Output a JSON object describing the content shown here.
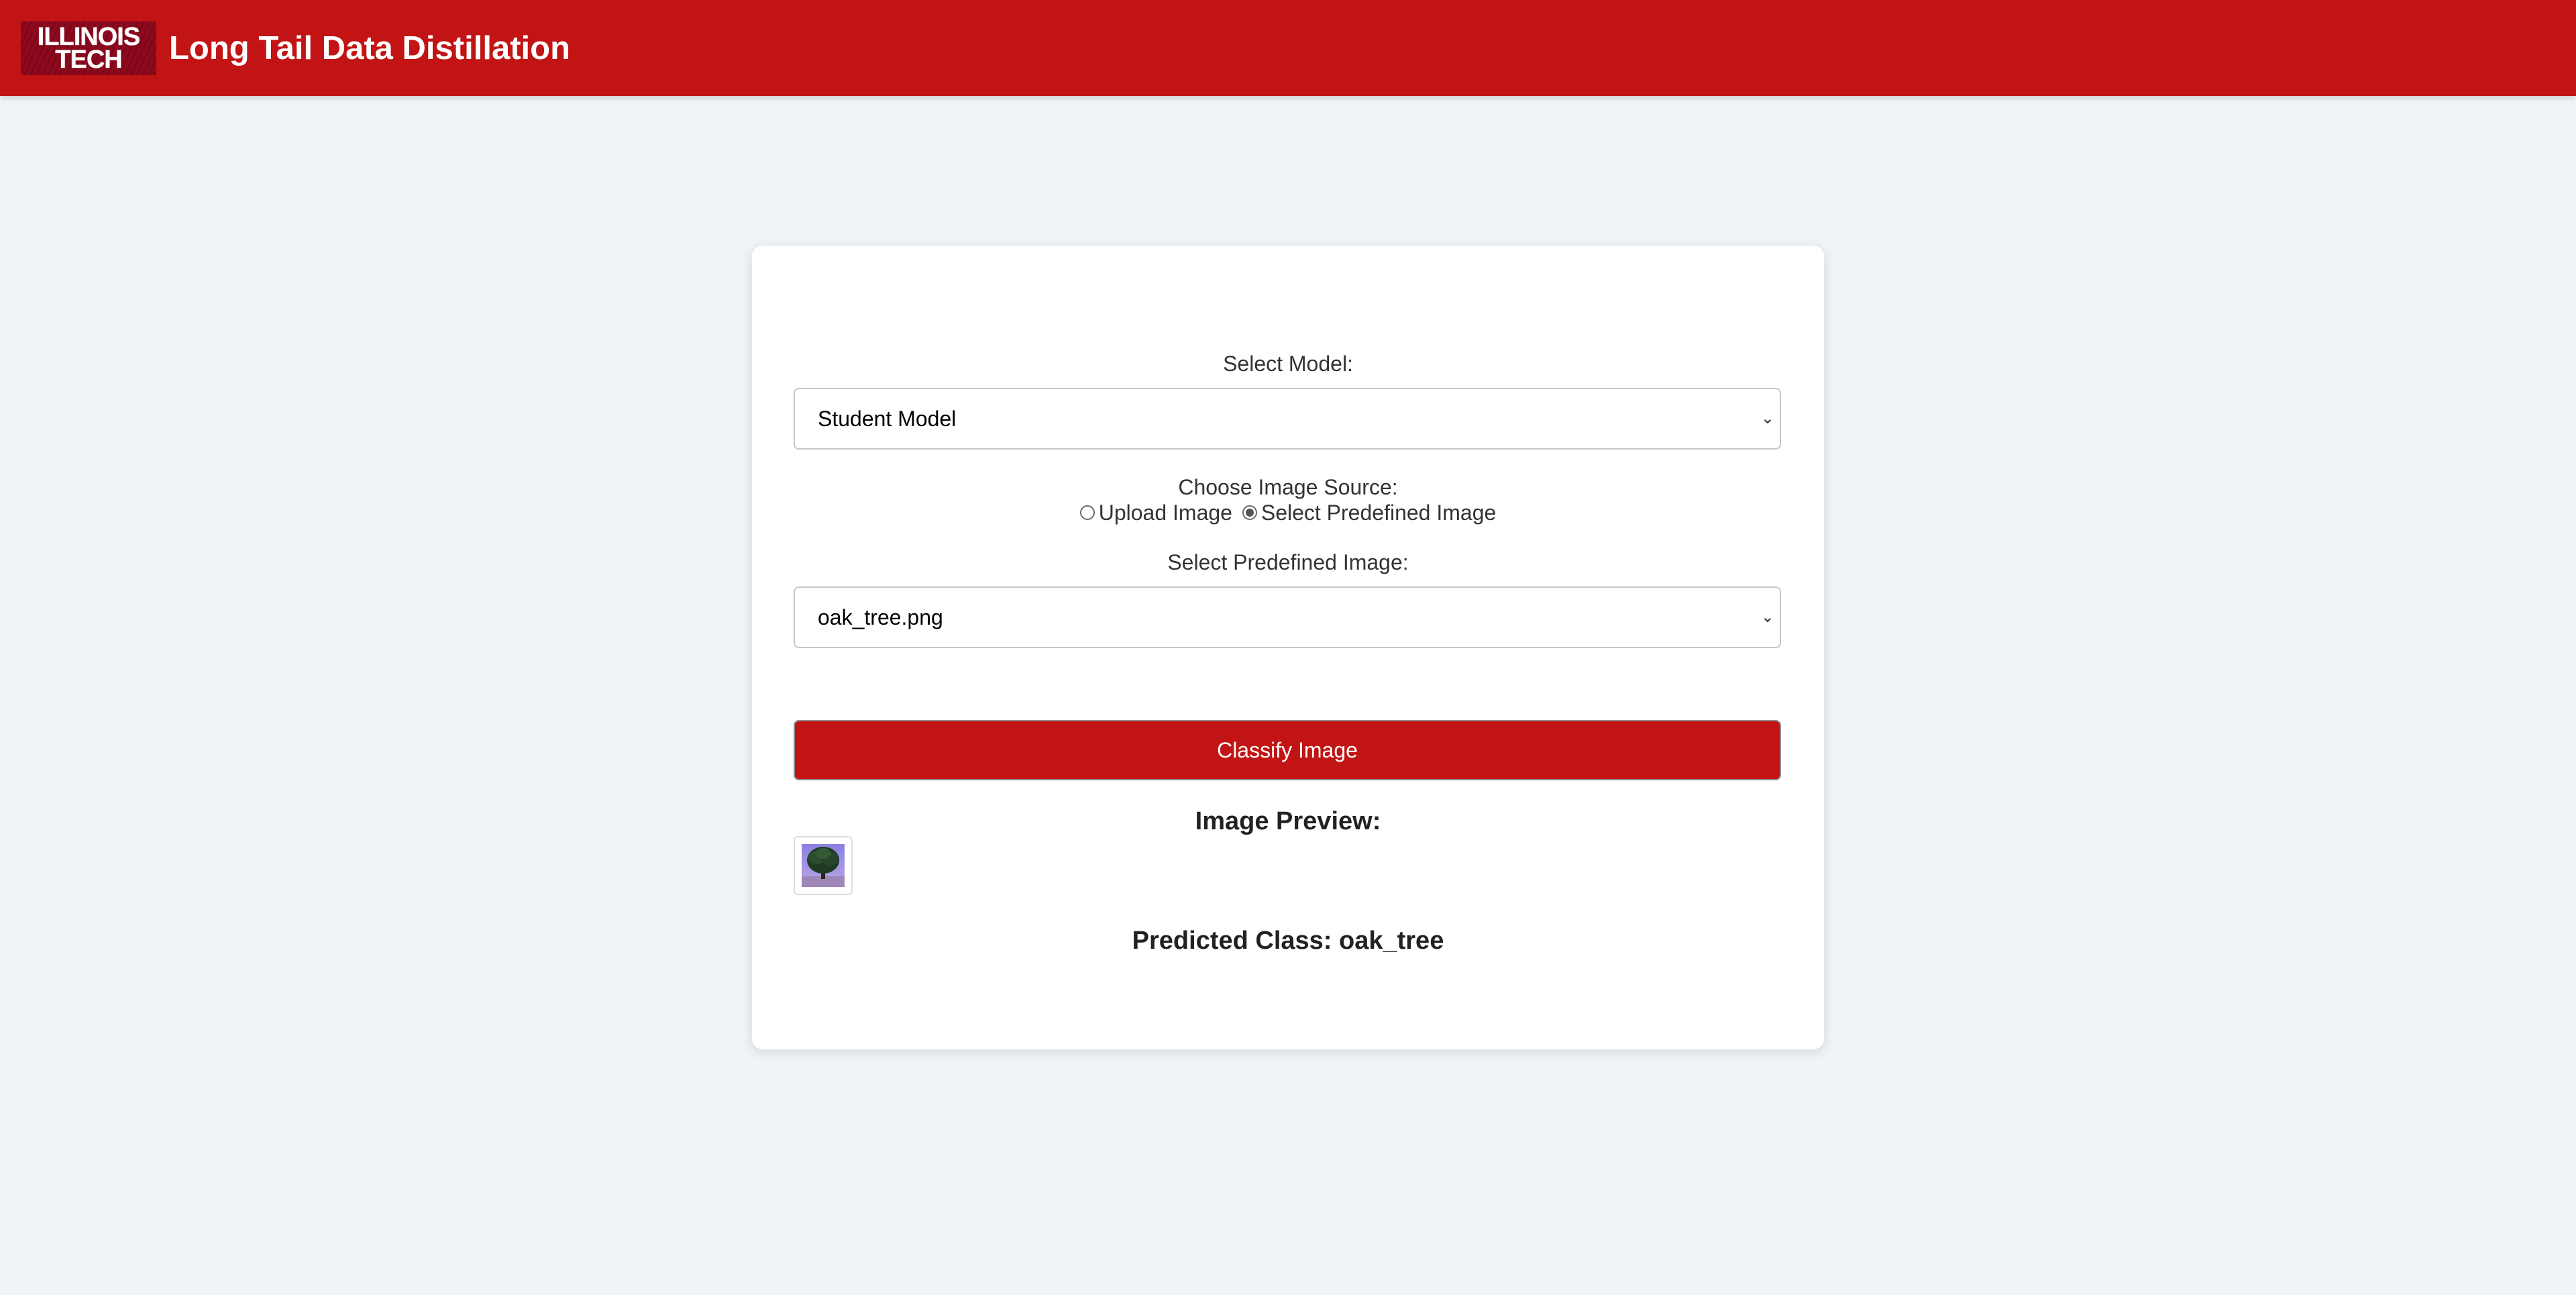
{
  "header": {
    "logo_line1": "ILLINOIS",
    "logo_line2": "TECH",
    "title": "Long Tail Data Distillation"
  },
  "form": {
    "model_label": "Select Model:",
    "model_value": "Student Model",
    "source_label": "Choose Image Source:",
    "source_options": [
      {
        "label": "Upload Image",
        "checked": false
      },
      {
        "label": "Select Predefined Image",
        "checked": true
      }
    ],
    "predefined_label": "Select Predefined Image:",
    "predefined_value": "oak_tree.png",
    "classify_label": "Classify Image",
    "preview_title": "Image Preview:",
    "predicted_text": "Predicted Class: oak_tree"
  },
  "colors": {
    "brand_red": "#c21414",
    "background": "#f0f4f7",
    "card": "#ffffff"
  },
  "icons": {
    "select_chevron": "chevron-down-icon",
    "thumbnail": "oak-tree-thumbnail"
  }
}
